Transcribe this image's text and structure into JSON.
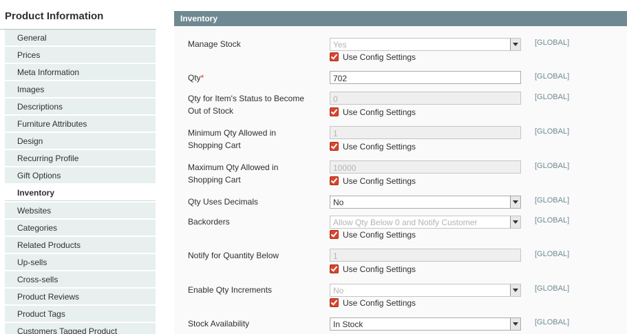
{
  "sidebar": {
    "title": "Product Information",
    "items": [
      {
        "label": "General"
      },
      {
        "label": "Prices"
      },
      {
        "label": "Meta Information"
      },
      {
        "label": "Images"
      },
      {
        "label": "Descriptions"
      },
      {
        "label": "Furniture Attributes"
      },
      {
        "label": "Design"
      },
      {
        "label": "Recurring Profile"
      },
      {
        "label": "Gift Options"
      },
      {
        "label": "Inventory"
      },
      {
        "label": "Websites"
      },
      {
        "label": "Categories"
      },
      {
        "label": "Related Products"
      },
      {
        "label": "Up-sells"
      },
      {
        "label": "Cross-sells"
      },
      {
        "label": "Product Reviews"
      },
      {
        "label": "Product Tags"
      },
      {
        "label": "Customers Tagged Product"
      }
    ]
  },
  "section": {
    "title": "Inventory"
  },
  "config_label": "Use Config Settings",
  "scope": "[GLOBAL]",
  "required_mark": "*",
  "fields": {
    "manage_stock": {
      "label": "Manage Stock",
      "value": "Yes"
    },
    "qty": {
      "label": "Qty",
      "value": "702"
    },
    "out_of_stock": {
      "label1": "Qty for Item's Status to Become",
      "label2": "Out of Stock",
      "value": "0"
    },
    "min_qty": {
      "label1": "Minimum Qty Allowed in",
      "label2": "Shopping Cart",
      "value": "1"
    },
    "max_qty": {
      "label1": "Maximum Qty Allowed in",
      "label2": "Shopping Cart",
      "value": "10000"
    },
    "decimals": {
      "label": "Qty Uses Decimals",
      "value": "No"
    },
    "backorders": {
      "label": "Backorders",
      "value": "Allow Qty Below 0 and Notify Customer"
    },
    "notify": {
      "label": "Notify for Quantity Below",
      "value": "1"
    },
    "qty_increments": {
      "label": "Enable Qty Increments",
      "value": "No"
    },
    "availability": {
      "label": "Stock Availability",
      "value": "In Stock"
    }
  }
}
